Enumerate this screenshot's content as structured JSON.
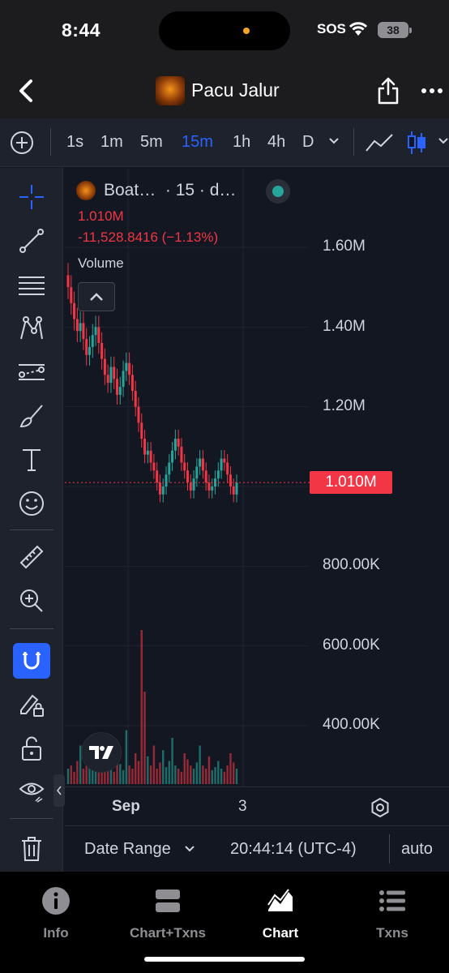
{
  "status_bar": {
    "time": "8:44",
    "sos": "SOS",
    "battery": "38"
  },
  "nav": {
    "title": "Pacu Jalur"
  },
  "timeframes": [
    {
      "label": "1s",
      "active": false
    },
    {
      "label": "1m",
      "active": false
    },
    {
      "label": "5m",
      "active": false
    },
    {
      "label": "15m",
      "active": true
    },
    {
      "label": "1h",
      "active": false
    },
    {
      "label": "4h",
      "active": false
    },
    {
      "label": "D",
      "active": false
    }
  ],
  "legend": {
    "symbol": "Boat…",
    "interval": "· 15 · d…",
    "last": "1.010M",
    "change": "-11,528.8416 (−1.13%)",
    "volume_label": "Volume"
  },
  "price_axis": [
    "1.60M",
    "1.40M",
    "1.20M",
    "1.010M",
    "800.00K",
    "600.00K",
    "400.00K"
  ],
  "last_price_label": "1.010M",
  "time_axis": {
    "label_1": "Sep",
    "label_2": "3"
  },
  "bottom_bar": {
    "date_range": "Date Range",
    "clock": "20:44:14 (UTC-4)",
    "scale": "auto"
  },
  "tabs": [
    {
      "label": "Info",
      "icon": "info-icon",
      "active": false
    },
    {
      "label": "Chart+Txns",
      "icon": "split-view-icon",
      "active": false
    },
    {
      "label": "Chart",
      "icon": "area-chart-icon",
      "active": true
    },
    {
      "label": "Txns",
      "icon": "list-icon",
      "active": false
    }
  ],
  "colors": {
    "accent": "#2962ff",
    "down": "#f23645",
    "up": "#26a69a",
    "background": "#131722"
  },
  "chart_data": {
    "type": "candlestick",
    "price_ylim": [
      300000,
      1700000
    ],
    "price_ticks": [
      400000,
      600000,
      800000,
      1200000,
      1400000,
      1600000
    ],
    "last_price": 1010000,
    "x_ticks": [
      "Sep",
      "3"
    ],
    "series": [
      {
        "name": "",
        "close_approx": [
          1500000,
          1460000,
          1420000,
          1390000,
          1410000,
          1370000,
          1330000,
          1350000,
          1380000,
          1400000,
          1360000,
          1320000,
          1280000,
          1260000,
          1300000,
          1270000,
          1230000,
          1250000,
          1290000,
          1310000,
          1280000,
          1240000,
          1200000,
          1160000,
          1120000,
          1080000,
          1090000,
          1060000,
          1040000,
          1010000,
          980000,
          1000000,
          1030000,
          1060000,
          1090000,
          1120000,
          1100000,
          1060000,
          1040000,
          1010000,
          990000,
          1020000,
          1050000,
          1070000,
          1040000,
          1010000,
          990000,
          1000000,
          1020000,
          1040000,
          1070000,
          1060000,
          1030000,
          1000000,
          980000,
          1010000
        ]
      }
    ],
    "volume": [
      0.1,
      0.12,
      0.08,
      0.15,
      0.25,
      0.1,
      0.2,
      0.12,
      0.09,
      0.18,
      0.3,
      0.14,
      0.1,
      0.22,
      0.11,
      0.08,
      0.16,
      0.13,
      0.09,
      0.35,
      0.12,
      0.1,
      0.2,
      0.15,
      1.0,
      0.6,
      0.18,
      0.12,
      0.25,
      0.1,
      0.14,
      0.22,
      0.11,
      0.15,
      0.3,
      0.12,
      0.1,
      0.08,
      0.2,
      0.16,
      0.12,
      0.1,
      0.14,
      0.25,
      0.12,
      0.1,
      0.18,
      0.09,
      0.11,
      0.15,
      0.1,
      0.08,
      0.12,
      0.2,
      0.14,
      0.1
    ]
  }
}
